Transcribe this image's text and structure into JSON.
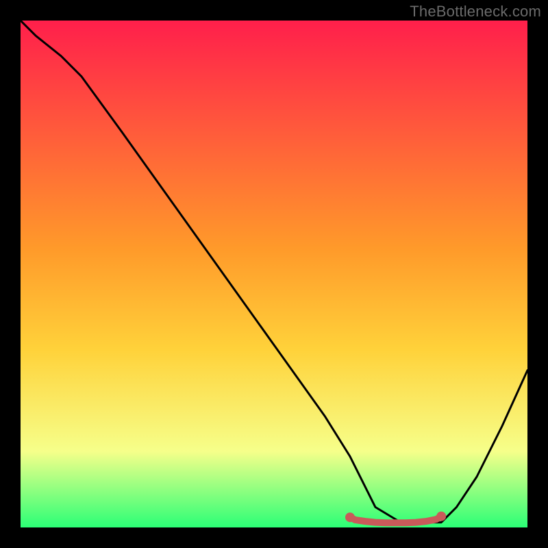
{
  "watermark": "TheBottleneck.com",
  "colors": {
    "background": "#000000",
    "gradient_top": "#ff1f4b",
    "gradient_mid": "#ffd23a",
    "gradient_low": "#f6ff8a",
    "gradient_bottom": "#2bff76",
    "curve": "#000000",
    "flat_marker": "#c95a5a"
  },
  "chart_data": {
    "type": "line",
    "title": "",
    "xlabel": "",
    "ylabel": "",
    "xlim": [
      0,
      100
    ],
    "ylim": [
      0,
      100
    ],
    "series": [
      {
        "name": "curve",
        "x": [
          0,
          3,
          8,
          12,
          20,
          30,
          40,
          50,
          60,
          65,
          68,
          70,
          75,
          80,
          83,
          86,
          90,
          95,
          100
        ],
        "y": [
          100,
          97,
          93,
          89,
          78,
          64,
          50,
          36,
          22,
          14,
          8,
          4,
          1,
          1,
          1,
          4,
          10,
          20,
          31
        ]
      },
      {
        "name": "flat-region",
        "x": [
          65,
          66,
          68,
          70,
          72,
          74,
          76,
          78,
          80,
          82,
          83
        ],
        "y": [
          2.0,
          1.5,
          1.2,
          1.0,
          0.9,
          0.9,
          0.9,
          1.0,
          1.2,
          1.6,
          2.2
        ]
      }
    ]
  }
}
